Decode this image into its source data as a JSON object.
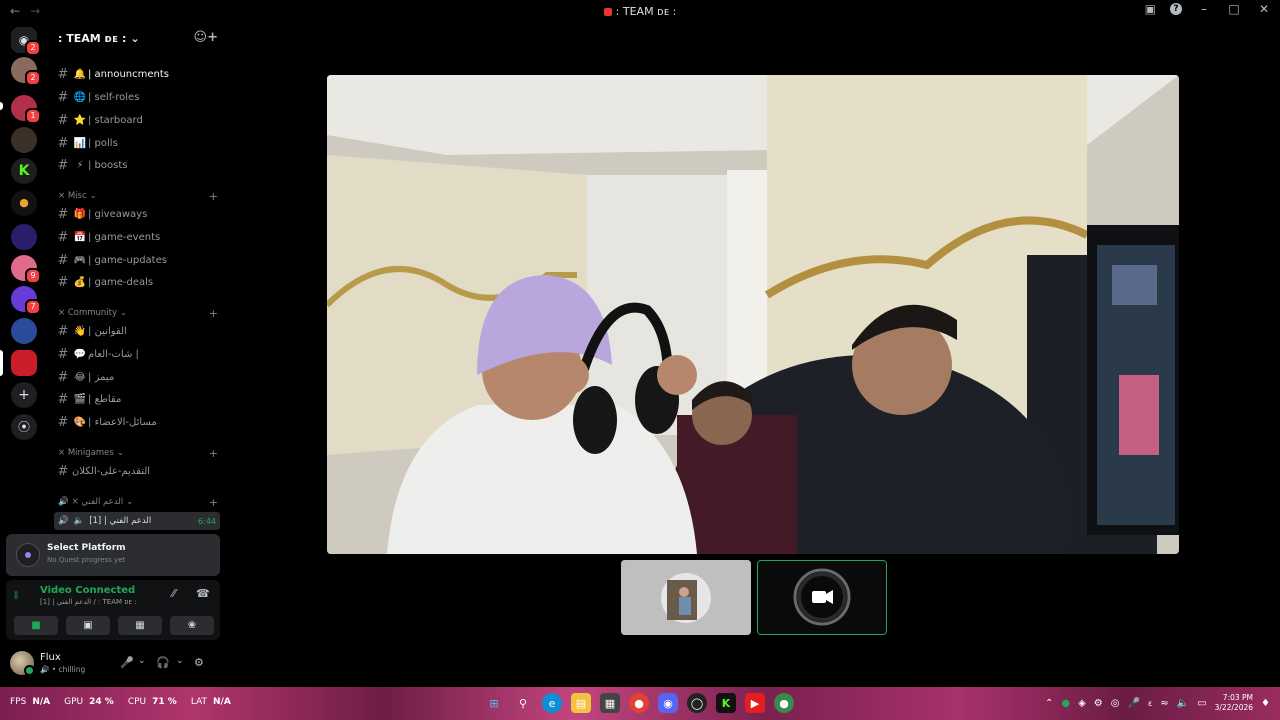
{
  "window": {
    "title": ": TEAM ᴅᴇ :",
    "back_icon": "arrow-left",
    "forward_icon": "arrow-right"
  },
  "rail": {
    "servers": [
      {
        "name": "discord-home",
        "badge": "2",
        "color": "#5865f2"
      },
      {
        "name": "server-avatar",
        "badge": "2",
        "color": "#8a6a5a"
      },
      {
        "name": "server-anime",
        "badge": "1",
        "color": "#b3304a"
      },
      {
        "name": "server-dark",
        "badge": "",
        "color": "#3a3028"
      },
      {
        "name": "server-kick",
        "badge": "",
        "color": "#1e1e1e"
      },
      {
        "name": "server-orange",
        "badge": "",
        "color": "#1a1a1a"
      },
      {
        "name": "server-infinite-store",
        "badge": "",
        "color": "#2a1d6a"
      },
      {
        "name": "server-pink",
        "badge": "9",
        "color": "#e06a8a"
      },
      {
        "name": "server-purple",
        "badge": "7",
        "color": "#6a3ad8"
      },
      {
        "name": "server-blue",
        "badge": "",
        "color": "#2a4a9a"
      },
      {
        "name": "server-team",
        "badge": "",
        "color": "#c81e2a"
      }
    ]
  },
  "sidebar": {
    "server_name": ": TEAM ᴅᴇ :",
    "channels_top": [
      {
        "emoji": "🔔",
        "label": "| announcments",
        "active": true
      },
      {
        "emoji": "🌐",
        "label": "| self-roles",
        "active": false
      },
      {
        "emoji": "⭐",
        "label": "| starboard",
        "active": false
      },
      {
        "emoji": "📊",
        "label": "| polls",
        "active": false
      },
      {
        "emoji": "⚡",
        "label": "| boosts",
        "active": false
      }
    ],
    "cat_misc": "× Misc",
    "channels_misc": [
      {
        "emoji": "🎁",
        "label": "| giveaways"
      },
      {
        "emoji": "📅",
        "label": "| game-events"
      },
      {
        "emoji": "🎮",
        "label": "| game-updates"
      },
      {
        "emoji": "💰",
        "label": "| game-deals"
      }
    ],
    "cat_community": "× Community",
    "channels_community": [
      {
        "emoji": "👋",
        "label": "| القوانين"
      },
      {
        "emoji": "💬",
        "label": "شات-العام |"
      },
      {
        "emoji": "😂",
        "label": "| ميمز"
      },
      {
        "emoji": "🎬",
        "label": "| مقاطع"
      },
      {
        "emoji": "🎨",
        "label": "| مسائل-الاعضاء"
      }
    ],
    "cat_minigames": "× Minigames",
    "channels_minigames": [
      {
        "emoji": "",
        "label": "التقديم-على-الكلان"
      }
    ],
    "cat_support": "× الدعم الفني",
    "voice_channel": {
      "label": "[1] | الدعم الفني",
      "timer": "6:44"
    }
  },
  "platform": {
    "title": "Select Platform",
    "subtitle": "No Quest progress yet"
  },
  "voice_panel": {
    "status": "Video Connected",
    "channel": "[1] | الدعم الفني / : TEAM ᴅᴇ :"
  },
  "user": {
    "name": "Flux",
    "status": "chilling"
  },
  "taskbar": {
    "fps_label": "FPS",
    "fps_value": "N/A",
    "gpu_label": "GPU",
    "gpu_value": "24 %",
    "cpu_label": "CPU",
    "cpu_value": "71 %",
    "lat_label": "LAT",
    "lat_value": "N/A",
    "time": "7:03 PM",
    "date": "3/22/2026"
  }
}
